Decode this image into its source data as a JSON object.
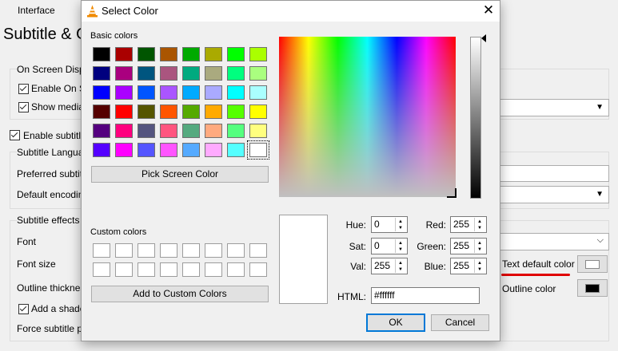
{
  "background": {
    "tab_label": "Interface",
    "page_title": "Subtitle & O",
    "osd_group": "On Screen Displa",
    "enable_osd": "Enable On Sc",
    "show_media": "Show media t",
    "enable_subtitles": "Enable subtitles",
    "subtitle_language": "Subtitle Languag",
    "preferred_subtitle": "Preferred subtitl",
    "default_encoding": "Default encoding",
    "subtitle_effects": "Subtitle effects",
    "font": "Font",
    "font_size": "Font size",
    "outline_thickness": "Outline thicknes",
    "add_shadow": "Add a shadow",
    "force_position": "Force subtitle po",
    "text_default_color": "Text default color",
    "outline_color": "Outline color",
    "colors": {
      "text_default": "#ffffff",
      "outline": "#000000",
      "underline": "#e00000"
    }
  },
  "dialog": {
    "title": "Select Color",
    "basic_colors_label": "Basic colors",
    "basic_colors": [
      [
        "#000000",
        "#aa0000",
        "#005500",
        "#aa5500",
        "#00aa00",
        "#aaaa00",
        "#00ff00",
        "#aaff00"
      ],
      [
        "#00007f",
        "#aa007f",
        "#00557f",
        "#aa557f",
        "#00aa7f",
        "#aaaa7f",
        "#00ff7f",
        "#aaff7f"
      ],
      [
        "#0000ff",
        "#aa00ff",
        "#0055ff",
        "#aa55ff",
        "#00aaff",
        "#aaaaff",
        "#00ffff",
        "#aaffff"
      ],
      [
        "#550000",
        "#ff0000",
        "#555500",
        "#ff5500",
        "#55aa00",
        "#ffaa00",
        "#55ff00",
        "#ffff00"
      ],
      [
        "#55007f",
        "#ff007f",
        "#55557f",
        "#ff557f",
        "#55aa7f",
        "#ffaa7f",
        "#55ff7f",
        "#ffff7f"
      ],
      [
        "#5500ff",
        "#ff00ff",
        "#5555ff",
        "#ff55ff",
        "#55aaff",
        "#ffaaff",
        "#55ffff",
        "#ffffff"
      ]
    ],
    "pick_screen_color": "Pick Screen Color",
    "custom_colors_label": "Custom colors",
    "add_custom": "Add to Custom Colors",
    "hue_label": "Hue:",
    "hue": "0",
    "sat_label": "Sat:",
    "sat": "0",
    "val_label": "Val:",
    "val": "255",
    "red_label": "Red:",
    "red": "255",
    "green_label": "Green:",
    "green": "255",
    "blue_label": "Blue:",
    "blue": "255",
    "html_label": "HTML:",
    "html": "#ffffff",
    "ok": "OK",
    "cancel": "Cancel",
    "current_color": "#ffffff"
  }
}
